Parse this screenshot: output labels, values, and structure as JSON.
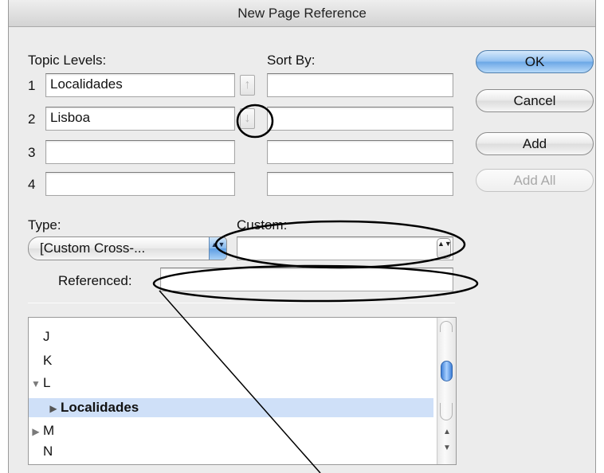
{
  "dialog": {
    "title": "New Page Reference"
  },
  "topic_levels": {
    "label": "Topic Levels:",
    "sort_by_label": "Sort By:",
    "rows": [
      {
        "num": "1",
        "value": "Localidades",
        "sort": ""
      },
      {
        "num": "2",
        "value": "Lisboa",
        "sort": ""
      },
      {
        "num": "3",
        "value": "",
        "sort": ""
      },
      {
        "num": "4",
        "value": "",
        "sort": ""
      }
    ],
    "up_arrow": "↑",
    "down_arrow": "↓"
  },
  "buttons": {
    "ok": "OK",
    "cancel": "Cancel",
    "add": "Add",
    "add_all": "Add All"
  },
  "type": {
    "label": "Type:",
    "value": "[Custom Cross-..."
  },
  "custom": {
    "label": "Custom:",
    "value": ""
  },
  "referenced": {
    "label": "Referenced:",
    "value": ""
  },
  "topic_list": {
    "items": [
      {
        "label": "J",
        "expander": ""
      },
      {
        "label": "K",
        "expander": ""
      },
      {
        "label": "L",
        "expander": "▼"
      },
      {
        "label": "Localidades",
        "expander": "▶"
      },
      {
        "label": "M",
        "expander": "▶"
      },
      {
        "label": "N",
        "expander": ""
      }
    ]
  },
  "icons": {
    "popup_arrows": "▲▼",
    "stepper_arrows": "▲▼",
    "scroll_up": "▲",
    "scroll_down": "▼"
  },
  "colors": {
    "selection": "#cfe0f8",
    "ok_button": "#6aa6e6",
    "annotation": "#000000"
  }
}
